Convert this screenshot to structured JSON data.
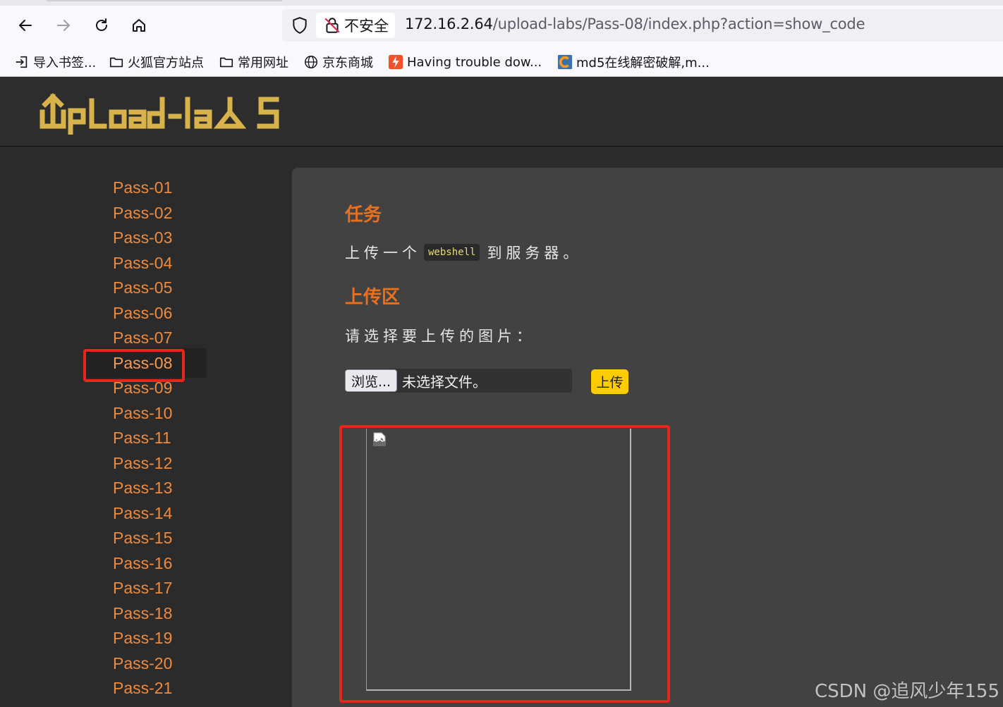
{
  "browser": {
    "security_label": "不安全",
    "url_host": "172.16.2.64",
    "url_path": "/upload-labs/Pass-08/index.php?action=show_code",
    "bookmarks": [
      {
        "label": "导入书签...",
        "icon": "import-icon"
      },
      {
        "label": "火狐官方站点",
        "icon": "folder-icon"
      },
      {
        "label": "常用网址",
        "icon": "folder-icon"
      },
      {
        "label": "京东商城",
        "icon": "globe-icon"
      },
      {
        "label": "Having trouble dow...",
        "icon": "site-favicon"
      },
      {
        "label": "md5在线解密破解,m...",
        "icon": "site-favicon"
      }
    ]
  },
  "header": {
    "logo_text": "UpLoad-labs"
  },
  "sidebar": {
    "items": [
      "Pass-01",
      "Pass-02",
      "Pass-03",
      "Pass-04",
      "Pass-05",
      "Pass-06",
      "Pass-07",
      "Pass-08",
      "Pass-09",
      "Pass-10",
      "Pass-11",
      "Pass-12",
      "Pass-13",
      "Pass-14",
      "Pass-15",
      "Pass-16",
      "Pass-17",
      "Pass-18",
      "Pass-19",
      "Pass-20",
      "Pass-21"
    ],
    "active": "Pass-08"
  },
  "main": {
    "task_title": "任务",
    "task_before": "上传一个",
    "task_code": "webshell",
    "task_after": "到服务器。",
    "upload_title": "上传区",
    "upload_prompt": "请选择要上传的图片：",
    "browse_label": "浏览...",
    "file_status": "未选择文件。",
    "upload_button": "上传"
  },
  "watermark": "CSDN @追风少年155",
  "colors": {
    "accent_orange": "#e8701f",
    "link_orange": "#ef8a3c",
    "logo_gold": "#d8b24a",
    "button_yellow": "#ffcc00",
    "highlight_red": "#e4261b"
  }
}
